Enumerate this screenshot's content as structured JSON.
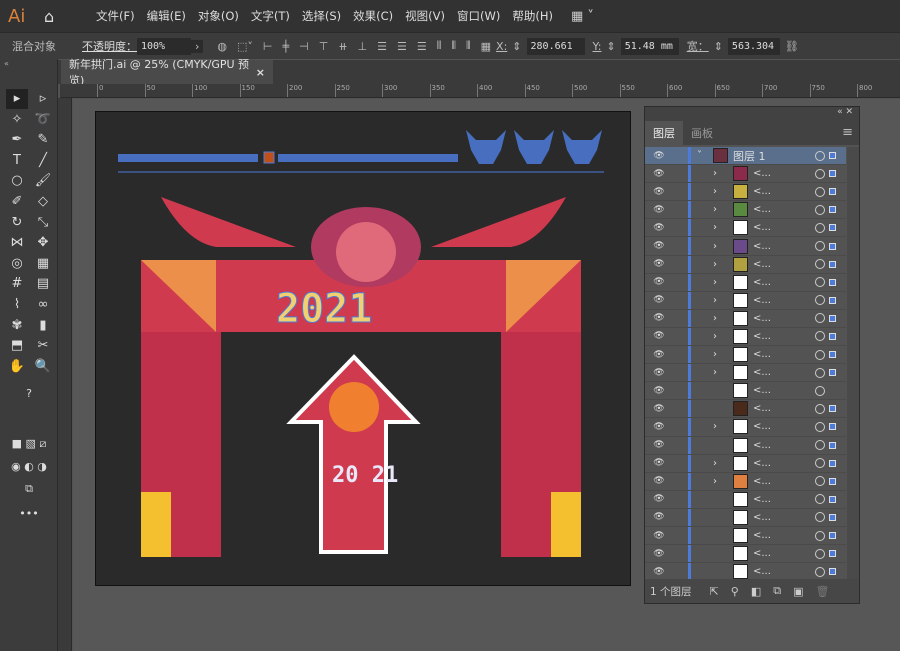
{
  "app": {
    "logo": "Ai",
    "home_icon": "home-icon"
  },
  "menu": [
    "文件(F)",
    "编辑(E)",
    "对象(O)",
    "文字(T)",
    "选择(S)",
    "效果(C)",
    "视图(V)",
    "窗口(W)",
    "帮助(H)"
  ],
  "control": {
    "object_type": "混合对象",
    "opacity_label": "不透明度：",
    "opacity": "100%",
    "x_label": "X:",
    "x": "280.661",
    "y_label": "Y:",
    "y": "51.48 mm",
    "w_label": "宽：",
    "w": "563.304"
  },
  "document_tab": {
    "title": "新年拱门.ai @ 25% (CMYK/GPU 预览)",
    "close": "×"
  },
  "ruler_ticks": [
    "0",
    "50",
    "100",
    "150",
    "200",
    "250",
    "300",
    "350",
    "400",
    "450",
    "500",
    "550",
    "600",
    "650",
    "700",
    "750",
    "800"
  ],
  "artwork": {
    "year_top": "2021",
    "year_arrow": "20 21"
  },
  "layers_panel": {
    "tabs": [
      "图层",
      "画板"
    ],
    "layer_name": "图层 1",
    "sublayer_label": "<...",
    "rows": [
      {
        "chev": true,
        "thumb": "#8b2a4a"
      },
      {
        "chev": true,
        "thumb": "#c8b040"
      },
      {
        "chev": true,
        "thumb": "#5a8a40"
      },
      {
        "chev": true,
        "thumb": "#ffffff"
      },
      {
        "chev": true,
        "thumb": "#6b4a8a"
      },
      {
        "chev": true,
        "thumb": "#b0a040"
      },
      {
        "chev": true,
        "thumb": "#ffffff"
      },
      {
        "chev": true,
        "thumb": "#ffffff"
      },
      {
        "chev": true,
        "thumb": "#ffffff"
      },
      {
        "chev": true,
        "thumb": "#ffffff"
      },
      {
        "chev": true,
        "thumb": "#ffffff"
      },
      {
        "chev": true,
        "thumb": "#ffffff"
      },
      {
        "chev": false,
        "thumb": "#ffffff",
        "no_sq": true
      },
      {
        "chev": false,
        "thumb": "#4a2a1a"
      },
      {
        "chev": true,
        "thumb": "#ffffff"
      },
      {
        "chev": false,
        "thumb": "#ffffff"
      },
      {
        "chev": true,
        "thumb": "#ffffff"
      },
      {
        "chev": true,
        "thumb": "#e08040"
      },
      {
        "chev": false,
        "thumb": "#ffffff"
      },
      {
        "chev": false,
        "thumb": "#ffffff"
      },
      {
        "chev": false,
        "thumb": "#ffffff"
      },
      {
        "chev": false,
        "thumb": "#ffffff"
      },
      {
        "chev": false,
        "thumb": "#ffffff"
      },
      {
        "chev": false,
        "thumb": "#ffffff"
      }
    ],
    "footer": "1 个图层"
  },
  "colors": {
    "accent": "#4d7bd9",
    "arch": "#d03a4e",
    "canvas": "#2a2a2a"
  }
}
